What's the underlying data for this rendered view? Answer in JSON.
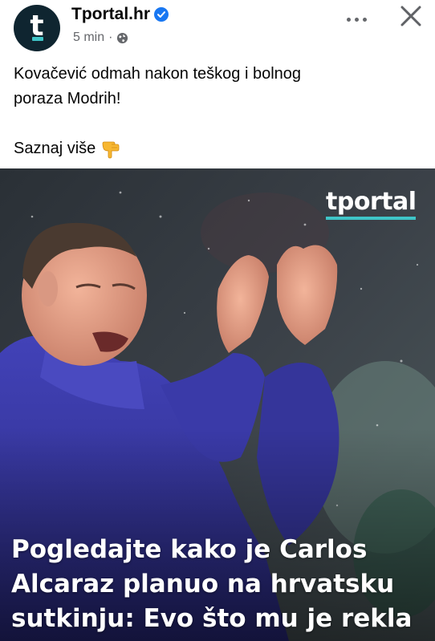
{
  "post": {
    "page_name": "Tportal.hr",
    "time": "5 min",
    "separator": "·",
    "avatar_letter": "t",
    "text_lines": [
      "Kovačević odmah nakon teškog i bolnog",
      "poraza Modrih!"
    ],
    "cta": "Saznaj više"
  },
  "image": {
    "brand": "tportal",
    "headline_lines": [
      "Pogledajte kako je Carlos",
      "Alcaraz planuo na hrvatsku",
      "sutkinju: Evo što mu je rekla"
    ]
  },
  "icons": {
    "verified": "verified-badge-icon",
    "privacy": "globe-icon",
    "more": "more-options-icon",
    "close": "close-icon",
    "cta_emoji": "pointing-down-hand-emoji"
  },
  "colors": {
    "brand_teal": "#3fc5c8",
    "avatar_bg": "#0f2530",
    "verified_blue": "#1877f2",
    "meta_gray": "#65676b",
    "jacket_purple": "#3a3aa0"
  }
}
